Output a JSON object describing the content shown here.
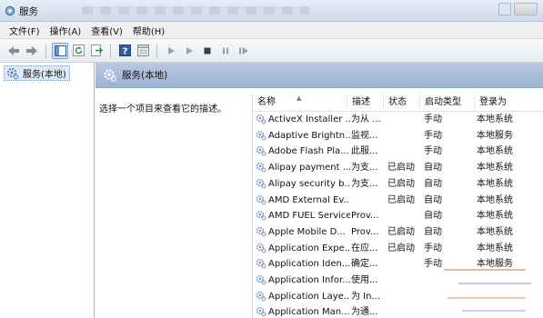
{
  "window": {
    "title": "服务"
  },
  "menu": [
    "文件(F)",
    "操作(A)",
    "查看(V)",
    "帮助(H)"
  ],
  "toolbar": {
    "buttons": [
      "back-icon",
      "forward-icon",
      "show-hide-tree-icon",
      "refresh-icon",
      "export-list-icon",
      "help-icon",
      "properties-icon",
      "start-service-icon",
      "start-service-alt-icon",
      "stop-service-icon",
      "pause-service-icon",
      "restart-service-icon"
    ]
  },
  "tree": {
    "root_label": "服务(本地)"
  },
  "pane": {
    "header_title": "服务(本地)",
    "description_hint": "选择一个项目来查看它的描述。"
  },
  "table": {
    "columns": [
      "名称",
      "描述",
      "状态",
      "启动类型",
      "登录为"
    ],
    "rows": [
      {
        "name": "ActiveX Installer ...",
        "desc": "为从 ...",
        "status": "",
        "start": "手动",
        "logon": "本地系统"
      },
      {
        "name": "Adaptive Brightn...",
        "desc": "监视...",
        "status": "",
        "start": "手动",
        "logon": "本地服务"
      },
      {
        "name": "Adobe Flash Pla...",
        "desc": "此服...",
        "status": "",
        "start": "手动",
        "logon": "本地系统"
      },
      {
        "name": "Alipay payment ...",
        "desc": "为支...",
        "status": "已启动",
        "start": "自动",
        "logon": "本地系统"
      },
      {
        "name": "Alipay security b...",
        "desc": "为支...",
        "status": "已启动",
        "start": "自动",
        "logon": "本地系统"
      },
      {
        "name": "AMD External Ev...",
        "desc": "",
        "status": "已启动",
        "start": "自动",
        "logon": "本地系统"
      },
      {
        "name": "AMD FUEL Service",
        "desc": "Prov...",
        "status": "",
        "start": "自动",
        "logon": "本地系统"
      },
      {
        "name": "Apple Mobile D...",
        "desc": "Prov...",
        "status": "已启动",
        "start": "自动",
        "logon": "本地系统"
      },
      {
        "name": "Application Expe...",
        "desc": "在应...",
        "status": "已启动",
        "start": "手动",
        "logon": "本地系统"
      },
      {
        "name": "Application Iden...",
        "desc": "确定...",
        "status": "",
        "start": "手动",
        "logon": "本地服务"
      },
      {
        "name": "Application Infor...",
        "desc": "使用...",
        "status": "",
        "start": "",
        "logon": ""
      },
      {
        "name": "Application Laye...",
        "desc": "为 In...",
        "status": "",
        "start": "",
        "logon": ""
      },
      {
        "name": "Application Man...",
        "desc": "为通...",
        "status": "",
        "start": "",
        "logon": ""
      }
    ]
  },
  "colors": {
    "header_band": "#a8bcd9",
    "selection": "#dfe9f5",
    "gear": "#5a86b8"
  }
}
